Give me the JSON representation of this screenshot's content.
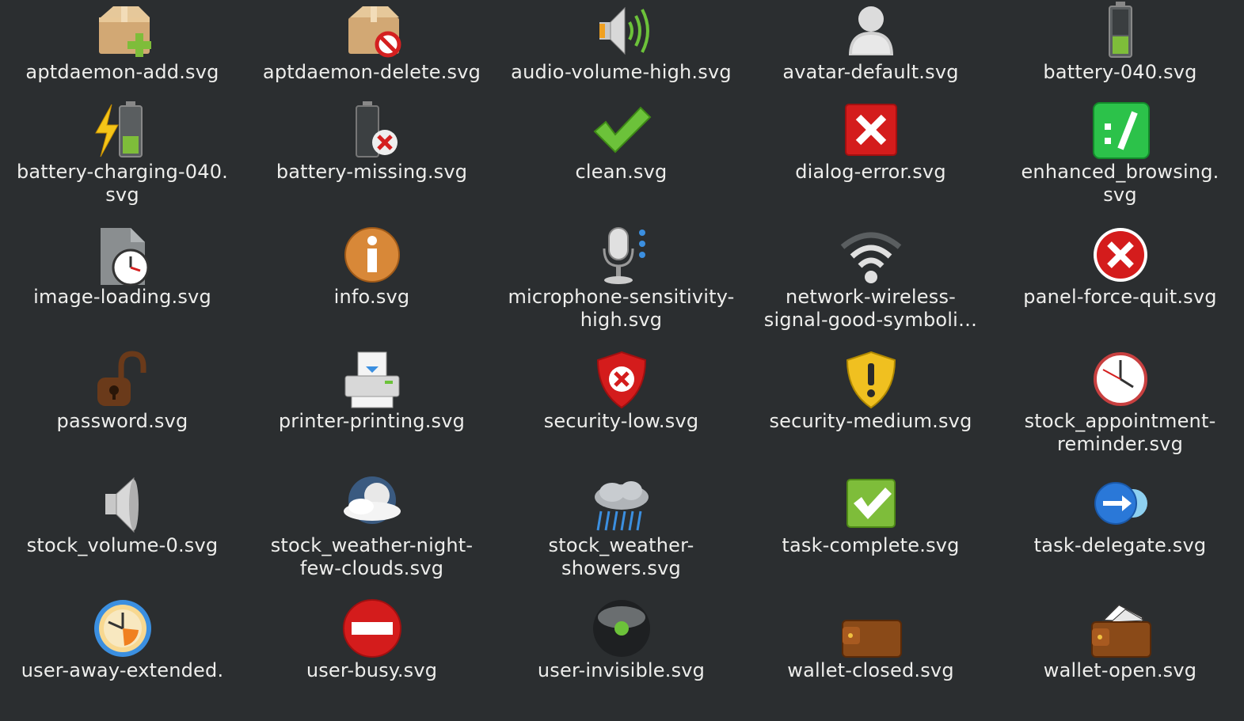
{
  "window": {
    "title": ""
  },
  "items": [
    {
      "label": "aptdaemon-add.svg",
      "icon": "package-add-icon"
    },
    {
      "label": "aptdaemon-delete.svg",
      "icon": "package-delete-icon"
    },
    {
      "label": "audio-volume-high.svg",
      "icon": "speaker-high-icon"
    },
    {
      "label": "avatar-default.svg",
      "icon": "avatar-icon"
    },
    {
      "label": "battery-040.svg",
      "icon": "battery-icon"
    },
    {
      "label": "battery-charging-040.\nsvg",
      "icon": "battery-charging-icon"
    },
    {
      "label": "battery-missing.svg",
      "icon": "battery-missing-icon"
    },
    {
      "label": "clean.svg",
      "icon": "checkmark-icon"
    },
    {
      "label": "dialog-error.svg",
      "icon": "error-x-icon"
    },
    {
      "label": "enhanced_browsing.\nsvg",
      "icon": "enhanced-browsing-icon"
    },
    {
      "label": "image-loading.svg",
      "icon": "image-loading-icon"
    },
    {
      "label": "info.svg",
      "icon": "info-icon"
    },
    {
      "label": "microphone-sensitivity-\nhigh.svg",
      "icon": "microphone-icon"
    },
    {
      "label": "network-wireless-\nsignal-good-symboli…",
      "icon": "wifi-icon"
    },
    {
      "label": "panel-force-quit.svg",
      "icon": "force-quit-icon"
    },
    {
      "label": "password.svg",
      "icon": "padlock-icon"
    },
    {
      "label": "printer-printing.svg",
      "icon": "printer-icon"
    },
    {
      "label": "security-low.svg",
      "icon": "shield-low-icon"
    },
    {
      "label": "security-medium.svg",
      "icon": "shield-medium-icon"
    },
    {
      "label": "stock_appointment-\nreminder.svg",
      "icon": "clock-icon"
    },
    {
      "label": "stock_volume-0.svg",
      "icon": "speaker-mute-icon"
    },
    {
      "label": "stock_weather-night-\nfew-clouds.svg",
      "icon": "night-clouds-icon"
    },
    {
      "label": "stock_weather-\nshowers.svg",
      "icon": "rain-cloud-icon"
    },
    {
      "label": "task-complete.svg",
      "icon": "task-complete-icon"
    },
    {
      "label": "task-delegate.svg",
      "icon": "task-delegate-icon"
    },
    {
      "label": "user-away-extended.",
      "icon": "user-away-icon"
    },
    {
      "label": "user-busy.svg",
      "icon": "user-busy-icon"
    },
    {
      "label": "user-invisible.svg",
      "icon": "user-invisible-icon"
    },
    {
      "label": "wallet-closed.svg",
      "icon": "wallet-closed-icon"
    },
    {
      "label": "wallet-open.svg",
      "icon": "wallet-open-icon"
    }
  ],
  "colors": {
    "background": "#2b2e30",
    "text": "#eeeeec"
  }
}
